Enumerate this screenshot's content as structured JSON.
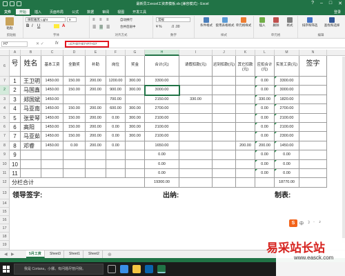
{
  "window": {
    "title": "最新员工excel工资表模板.xls [兼容模式] - Excel",
    "controls": [
      "?",
      "–",
      "□",
      "✕"
    ]
  },
  "tabs": [
    "文件",
    "开始",
    "插入",
    "页面布局",
    "公式",
    "数据",
    "审阅",
    "视图",
    "开发工具"
  ],
  "active_tab": "开始",
  "signin": "登录",
  "ribbon": {
    "font_name": "微软雅黑 Light",
    "font_size": "9",
    "number_format": "常规",
    "paste": "粘贴",
    "wrap": "自动换行",
    "merge": "合并后居中",
    "groups": [
      "剪贴板",
      "字体",
      "对齐方式",
      "数字",
      "样式",
      "单元格",
      "编辑"
    ],
    "buttons": [
      "条件格式",
      "套用表格格式",
      "单元格样式",
      "插入",
      "删除",
      "格式",
      "排序和筛选",
      "查找和选择"
    ]
  },
  "formula_bar": {
    "name_box": "H7",
    "fx": "fx",
    "formula": "=C7+D7+E7+F7+G7"
  },
  "columns": [
    "A",
    "B",
    "C",
    "D",
    "E",
    "F",
    "G",
    "H",
    "I",
    "J",
    "K",
    "L",
    "M",
    "N"
  ],
  "selected_column": "H",
  "selected_row": "7",
  "headers": {
    "no": "号",
    "name": "姓名",
    "base": "基本工资",
    "full": "全勤奖",
    "subsidy": "补助",
    "post": "岗位",
    "bonus": "奖金",
    "total": "合计(元)",
    "leave": "请假扣款(元)",
    "late": "迟到扣款(元)",
    "other": "其它扣款(元)",
    "deduct_total": "应扣合计(元)",
    "actual": "实发工资(元)",
    "sign": "签字"
  },
  "rows": [
    {
      "row": "7",
      "no": "1",
      "name": "王卫明",
      "c": "1450.00",
      "d": "150.00",
      "e": "200.00",
      "f": "1200.00",
      "g": "300.00",
      "h": "3300.00",
      "i": "",
      "j": "",
      "k": "",
      "l": "0.00",
      "m": "3300.00"
    },
    {
      "row": "7",
      "no": "2",
      "name": "马国鑫",
      "c": "1450.00",
      "d": "150.00",
      "e": "200.00",
      "f": "900.00",
      "g": "300.00",
      "h": "3000.00",
      "i": "",
      "j": "",
      "k": "",
      "l": "0.00",
      "m": "3000.00"
    },
    {
      "row": "8",
      "no": "3",
      "name": "郑国斌",
      "c": "1450.00",
      "d": "",
      "e": "",
      "f": "700.00",
      "g": "",
      "h": "2150.00",
      "i": "330.00",
      "j": "",
      "k": "",
      "l": "330.00",
      "m": "1820.00"
    },
    {
      "row": "5",
      "no": "4",
      "name": "马亚南",
      "c": "1450.00",
      "d": "150.00",
      "e": "200.00",
      "f": "600.00",
      "g": "300.00",
      "h": "2700.00",
      "i": "",
      "j": "",
      "k": "",
      "l": "0.00",
      "m": "2700.00"
    },
    {
      "row": "6",
      "no": "5",
      "name": "张爱琴",
      "c": "1450.00",
      "d": "150.00",
      "e": "200.00",
      "f": "0.00",
      "g": "300.00",
      "h": "2100.00",
      "i": "",
      "j": "",
      "k": "",
      "l": "0.00",
      "m": "2100.00"
    },
    {
      "row": "7",
      "no": "6",
      "name": "高阳",
      "c": "1450.00",
      "d": "150.00",
      "e": "200.00",
      "f": "0.00",
      "g": "300.00",
      "h": "2100.00",
      "i": "",
      "j": "",
      "k": "",
      "l": "0.00",
      "m": "2100.00"
    },
    {
      "row": "7",
      "no": "7",
      "name": "马亚茹",
      "c": "1450.00",
      "d": "150.00",
      "e": "200.00",
      "f": "0.00",
      "g": "300.00",
      "h": "2100.00",
      "i": "",
      "j": "",
      "k": "",
      "l": "0.00",
      "m": "2300.00"
    },
    {
      "row": "8",
      "no": "8",
      "name": "邓睿",
      "c": "1450.00",
      "d": "0.00",
      "e": "200.00",
      "f": "0.00",
      "g": "",
      "h": "1650.00",
      "i": "",
      "j": "",
      "k": "200.00",
      "l": "200.00",
      "m": "1450.00"
    },
    {
      "row": "9",
      "no": "9",
      "name": "",
      "c": "",
      "d": "",
      "e": "",
      "f": "",
      "g": "",
      "h": "0.00",
      "i": "",
      "j": "",
      "k": "",
      "l": "0.00",
      "m": "0.00"
    },
    {
      "row": "10",
      "no": "10",
      "name": "",
      "c": "",
      "d": "",
      "e": "",
      "f": "",
      "g": "",
      "h": "0.00",
      "i": "",
      "j": "",
      "k": "",
      "l": "0.00",
      "m": "0.00"
    },
    {
      "row": "11",
      "no": "11",
      "name": "",
      "c": "",
      "d": "",
      "e": "",
      "f": "",
      "g": "",
      "h": "0.00",
      "i": "",
      "j": "",
      "k": "",
      "l": "0.00",
      "m": "0.00"
    }
  ],
  "total_row": {
    "label": "分栏合计",
    "h": "19300.00",
    "m": "18770.00"
  },
  "signatures": {
    "leader": "领导签字:",
    "cashier": "出纳:",
    "maker": "制表:"
  },
  "row_numbers": [
    "6",
    "7",
    "2",
    "3",
    "4",
    "5",
    "6",
    "7",
    "8",
    "9",
    "10",
    "11",
    "12",
    "13",
    "14",
    "15",
    "16",
    "17",
    "18",
    "19",
    "20",
    "21"
  ],
  "sheet_tabs": [
    "5月工资",
    "Sheet3",
    "Sheet1",
    "Sheet2"
  ],
  "active_sheet": "5月工资",
  "taskbar": {
    "search": "我是 Cortana，小娜。有问题尽管问我。"
  },
  "watermark": {
    "text": "易采站长站",
    "url": "www.easck.com"
  }
}
